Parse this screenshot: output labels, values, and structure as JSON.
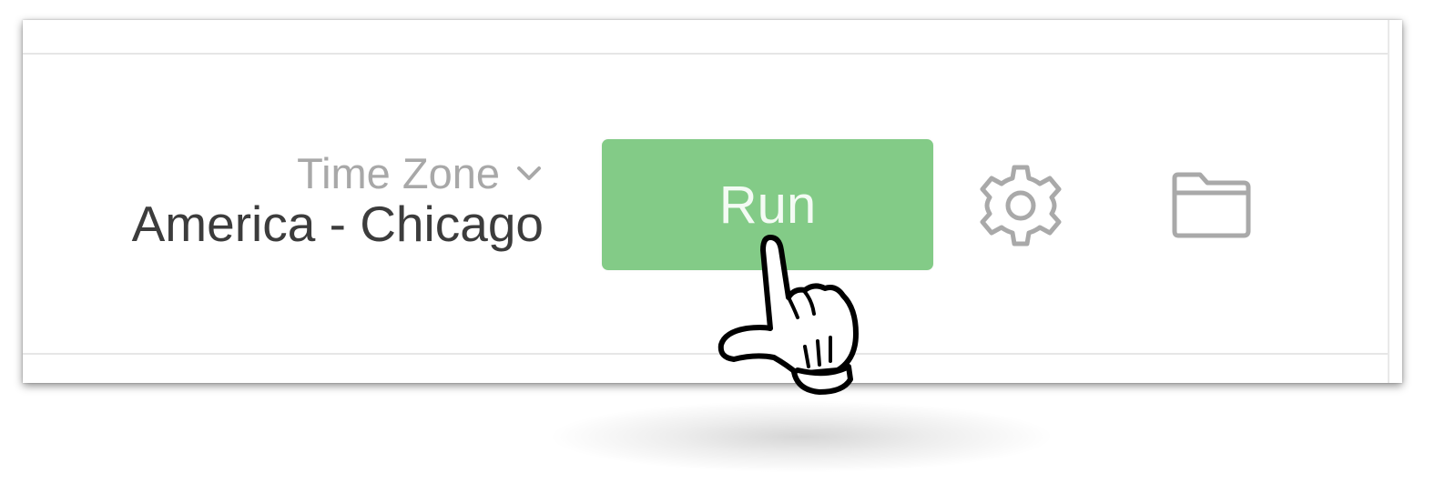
{
  "timezone": {
    "label": "Time Zone",
    "value": "America - Chicago",
    "dropdown_icon": "chevron-down-icon"
  },
  "toolbar": {
    "run_label": "Run",
    "settings_icon": "gear-icon",
    "folder_icon": "folder-icon"
  },
  "pointer": {
    "icon": "hand-pointer-cursor-icon"
  },
  "colors": {
    "run_button_bg": "#83cb87",
    "run_button_text": "#f4fbf4",
    "icon_gray": "#a9a9a9",
    "label_gray": "#a8a8a8",
    "value_text": "#3c3c3c",
    "divider": "#e6e6e6"
  }
}
